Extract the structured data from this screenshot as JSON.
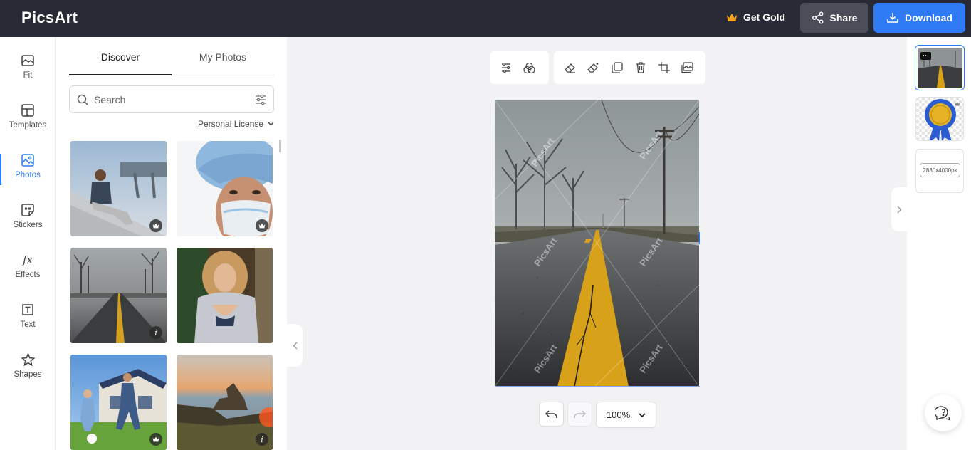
{
  "app": {
    "logo": "PicsArt"
  },
  "header": {
    "get_gold_label": "Get Gold",
    "share_label": "Share",
    "download_label": "Download"
  },
  "rail": {
    "items": [
      {
        "label": "Fit",
        "icon": "fit-icon"
      },
      {
        "label": "Templates",
        "icon": "templates-icon"
      },
      {
        "label": "Photos",
        "icon": "photos-icon",
        "active": true
      },
      {
        "label": "Stickers",
        "icon": "stickers-icon"
      },
      {
        "label": "Effects",
        "icon": "effects-icon"
      },
      {
        "label": "Text",
        "icon": "text-icon"
      },
      {
        "label": "Shapes",
        "icon": "shapes-icon"
      }
    ],
    "effects_glyph": "fx",
    "text_glyph": "T"
  },
  "panel": {
    "tabs": [
      {
        "label": "Discover",
        "active": true
      },
      {
        "label": "My Photos"
      }
    ],
    "search_placeholder": "Search",
    "license_label": "Personal License",
    "thumbnails": [
      {
        "subject": "man-sitting-on-concrete",
        "badge": "crown"
      },
      {
        "subject": "woman-with-surgical-mask",
        "badge": "crown"
      },
      {
        "subject": "foggy-road",
        "badge": "info",
        "badge_text": "i"
      },
      {
        "subject": "woman-in-silver-jacket",
        "badge": "none"
      },
      {
        "subject": "father-and-son-soccer",
        "badge": "crown"
      },
      {
        "subject": "coastline-sunset",
        "badge": "info",
        "badge_text": "i"
      }
    ]
  },
  "canvas": {
    "toolbar_group1": [
      "adjust-icon",
      "blend-icon"
    ],
    "toolbar_group2": [
      "eraser-icon",
      "magic-eraser-icon",
      "duplicate-icon",
      "delete-icon",
      "crop-icon",
      "replace-image-icon"
    ],
    "watermark": "PicsArt",
    "zoom_label": "100%"
  },
  "layers": {
    "items": [
      {
        "type": "photo",
        "selected": true,
        "menu_glyph": "···"
      },
      {
        "type": "sticker-badge",
        "selected": false
      },
      {
        "type": "background",
        "selected": false,
        "dimensions": "2880x4000px"
      }
    ]
  },
  "colors": {
    "topbar": "#282a36",
    "accent": "#2f7bf5",
    "gold": "#f5a623"
  }
}
